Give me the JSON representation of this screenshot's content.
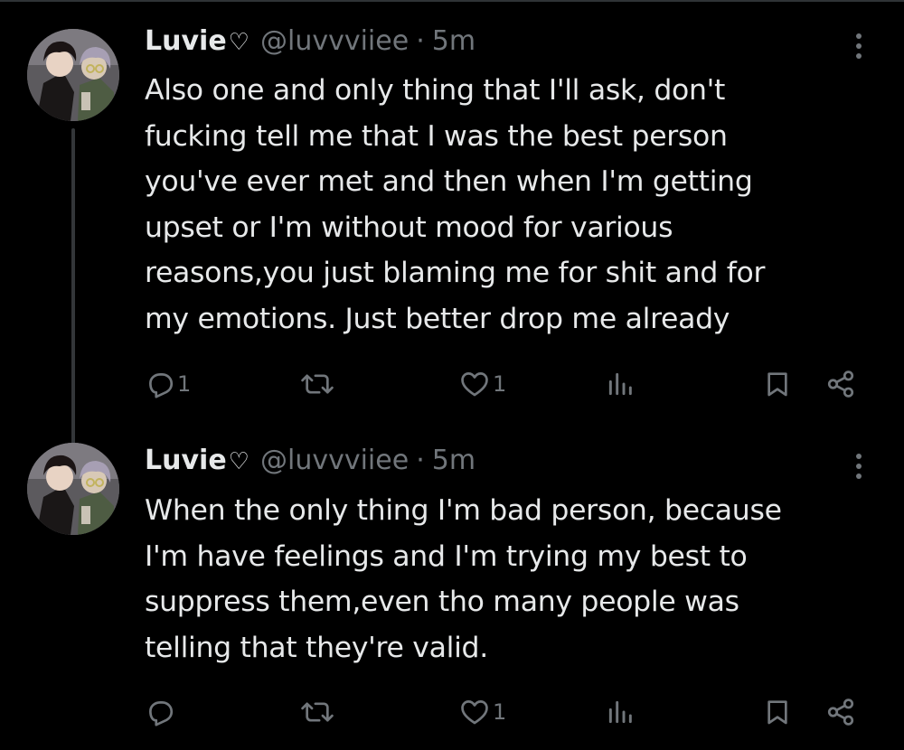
{
  "tweets": [
    {
      "name": "Luvie",
      "name_heart": "♡",
      "handle": "@luvvviiee",
      "separator": "·",
      "time": "5m",
      "text": "Also  one and only thing that I'll ask, don't\nfucking tell me that  I was the best person\nyou've ever met and then when I'm getting\nupset or I'm without mood for various\nreasons,you just blaming me for shit and for\nmy emotions. Just better drop me already",
      "actions": {
        "reply_count": "1",
        "retweet_count": "",
        "like_count": "1",
        "views_count": ""
      }
    },
    {
      "name": "Luvie",
      "name_heart": "♡",
      "handle": "@luvvviiee",
      "separator": "·",
      "time": "5m",
      "text": "When the only thing I'm  bad person, because\nI'm have feelings and I'm trying my best to\nsuppress them,even tho many people was\ntelling that they're valid.",
      "actions": {
        "reply_count": "",
        "retweet_count": "",
        "like_count": "1",
        "views_count": ""
      }
    }
  ],
  "icons": {
    "reply": "reply-icon",
    "retweet": "retweet-icon",
    "like": "heart-icon",
    "views": "views-icon",
    "bookmark": "bookmark-icon",
    "share": "share-icon",
    "more": "more-options-icon"
  },
  "colors": {
    "background": "#000000",
    "text_primary": "#e7e9ea",
    "text_secondary": "#71767b",
    "thread_line": "#333639"
  }
}
